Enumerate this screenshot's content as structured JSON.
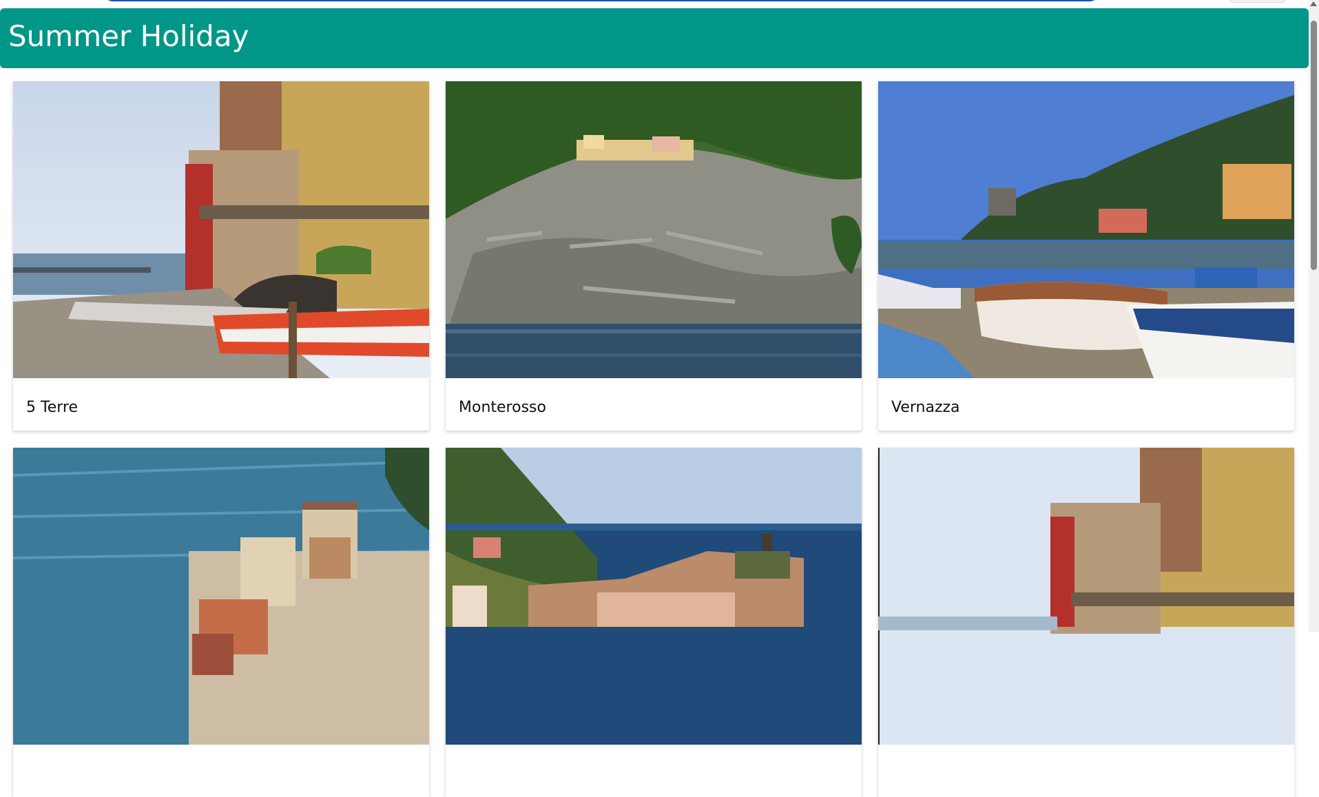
{
  "header": {
    "title": "Summer Holiday"
  },
  "gallery": {
    "cards": [
      {
        "caption": "5 Terre",
        "image": "harbor-boats-buildings"
      },
      {
        "caption": "Monterosso",
        "image": "cliff-village-sea"
      },
      {
        "caption": "Vernazza",
        "image": "beach-boats-hillside"
      },
      {
        "caption": "",
        "image": "sea-cliff-houses"
      },
      {
        "caption": "",
        "image": "coastal-town-tower"
      },
      {
        "caption": "",
        "image": "harbor-buildings"
      }
    ]
  },
  "colors": {
    "header_bg": "#009688",
    "page_bg": "#ffffff"
  }
}
